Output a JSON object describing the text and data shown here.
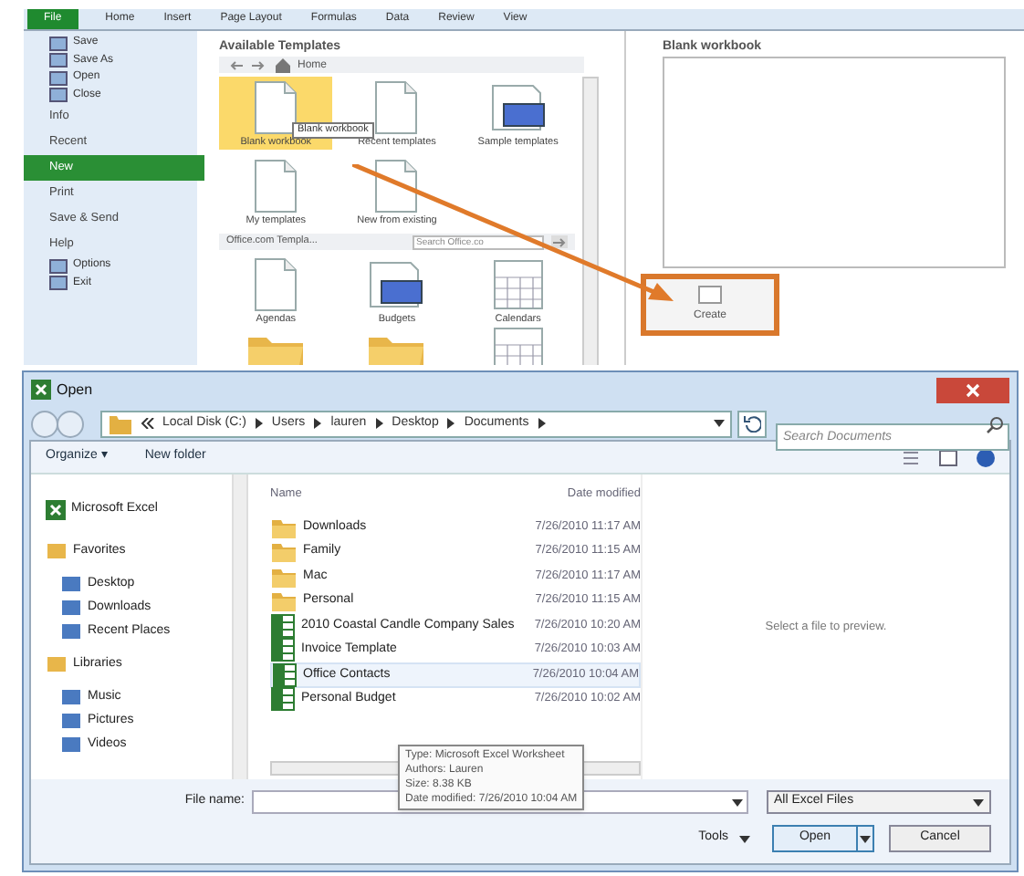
{
  "excel": {
    "ribbon_tabs": [
      {
        "label": "File",
        "selected": true
      },
      {
        "label": "Home",
        "selected": false
      },
      {
        "label": "Insert",
        "selected": false
      },
      {
        "label": "Page Layout",
        "selected": false
      },
      {
        "label": "Formulas",
        "selected": false
      },
      {
        "label": "Data",
        "selected": false
      },
      {
        "label": "Review",
        "selected": false
      },
      {
        "label": "View",
        "selected": false
      }
    ],
    "backstage_menu": [
      {
        "label": "Save",
        "kind": "command",
        "selected": false
      },
      {
        "label": "Save As",
        "kind": "command",
        "selected": false
      },
      {
        "label": "Open",
        "kind": "command",
        "selected": false
      },
      {
        "label": "Close",
        "kind": "command",
        "selected": false
      },
      {
        "label": "Info",
        "kind": "section",
        "selected": false
      },
      {
        "label": "Recent",
        "kind": "section",
        "selected": false
      },
      {
        "label": "New",
        "kind": "section",
        "selected": true
      },
      {
        "label": "Print",
        "kind": "section",
        "selected": false
      },
      {
        "label": "Save & Send",
        "kind": "section",
        "selected": false
      },
      {
        "label": "Help",
        "kind": "section",
        "selected": false
      },
      {
        "label": "Options",
        "kind": "command",
        "selected": false
      },
      {
        "label": "Exit",
        "kind": "command",
        "selected": false
      }
    ],
    "templates": {
      "title": "Available Templates",
      "nav_label": "Home",
      "items": [
        {
          "label": "Blank workbook",
          "kind": "page",
          "selected": true
        },
        {
          "label": "Recent templates",
          "kind": "page",
          "selected": false
        },
        {
          "label": "Sample templates",
          "kind": "screen",
          "selected": false
        },
        {
          "label": "My templates",
          "kind": "page",
          "selected": false
        },
        {
          "label": "New from existing",
          "kind": "page",
          "selected": false
        }
      ],
      "office_label": "Office.com Templa...",
      "search_placeholder": "Search Office.co",
      "office_items": [
        {
          "label": "Agendas",
          "kind": "page"
        },
        {
          "label": "Budgets",
          "kind": "screen"
        },
        {
          "label": "Calendars",
          "kind": "grid"
        },
        {
          "kind": "folder"
        },
        {
          "kind": "folder"
        },
        {
          "kind": "grid"
        }
      ],
      "tooltip": "Blank workbook"
    },
    "preview": {
      "title": "Blank workbook",
      "create_button": "Create"
    }
  },
  "open_dialog": {
    "title": "Open",
    "breadcrumb": [
      "Local Disk (C:)",
      "Users",
      "lauren",
      "Desktop",
      "Documents"
    ],
    "search_placeholder": "Search Documents",
    "toolbar": [
      "Organize ▾",
      "New folder"
    ],
    "nav": [
      {
        "label": "Microsoft Excel",
        "kind": "app"
      },
      {
        "label": "Favorites",
        "kind": "group",
        "children": [
          {
            "label": "Desktop",
            "kind": "item"
          },
          {
            "label": "Downloads",
            "kind": "item"
          },
          {
            "label": "Recent Places",
            "kind": "item"
          }
        ]
      },
      {
        "label": "Libraries",
        "kind": "group",
        "children": [
          {
            "label": "Music",
            "kind": "item"
          },
          {
            "label": "Pictures",
            "kind": "item"
          },
          {
            "label": "Videos",
            "kind": "item"
          }
        ]
      }
    ],
    "columns": [
      "Name",
      "Date modified"
    ],
    "files": [
      {
        "name": "Downloads",
        "kind": "folder",
        "date": "7/26/2010 11:17 AM",
        "hovered": false
      },
      {
        "name": "Family",
        "kind": "folder",
        "date": "7/26/2010 11:15 AM",
        "hovered": false
      },
      {
        "name": "Mac",
        "kind": "folder",
        "date": "7/26/2010 11:17 AM",
        "hovered": false
      },
      {
        "name": "Personal",
        "kind": "folder",
        "date": "7/26/2010 11:15 AM",
        "hovered": false
      },
      {
        "name": "2010 Coastal Candle Company Sales",
        "kind": "excel",
        "date": "7/26/2010 10:20 AM",
        "hovered": false
      },
      {
        "name": "Invoice Template",
        "kind": "excel",
        "date": "7/26/2010 10:03 AM",
        "hovered": false
      },
      {
        "name": "Office Contacts",
        "kind": "excel",
        "date": "7/26/2010 10:04 AM",
        "hovered": true
      },
      {
        "name": "Personal Budget",
        "kind": "excel",
        "date": "7/26/2010 10:02 AM",
        "hovered": false
      }
    ],
    "tooltip": [
      "Type: Microsoft Excel Worksheet",
      "Authors: Lauren",
      "Size: 8.38 KB",
      "Date modified: 7/26/2010 10:04 AM"
    ],
    "preview_message": "Select a file to preview.",
    "file_name_label": "File name:",
    "file_type": "All Excel Files",
    "tools": "Tools",
    "buttons": [
      "Open",
      "Cancel"
    ]
  }
}
